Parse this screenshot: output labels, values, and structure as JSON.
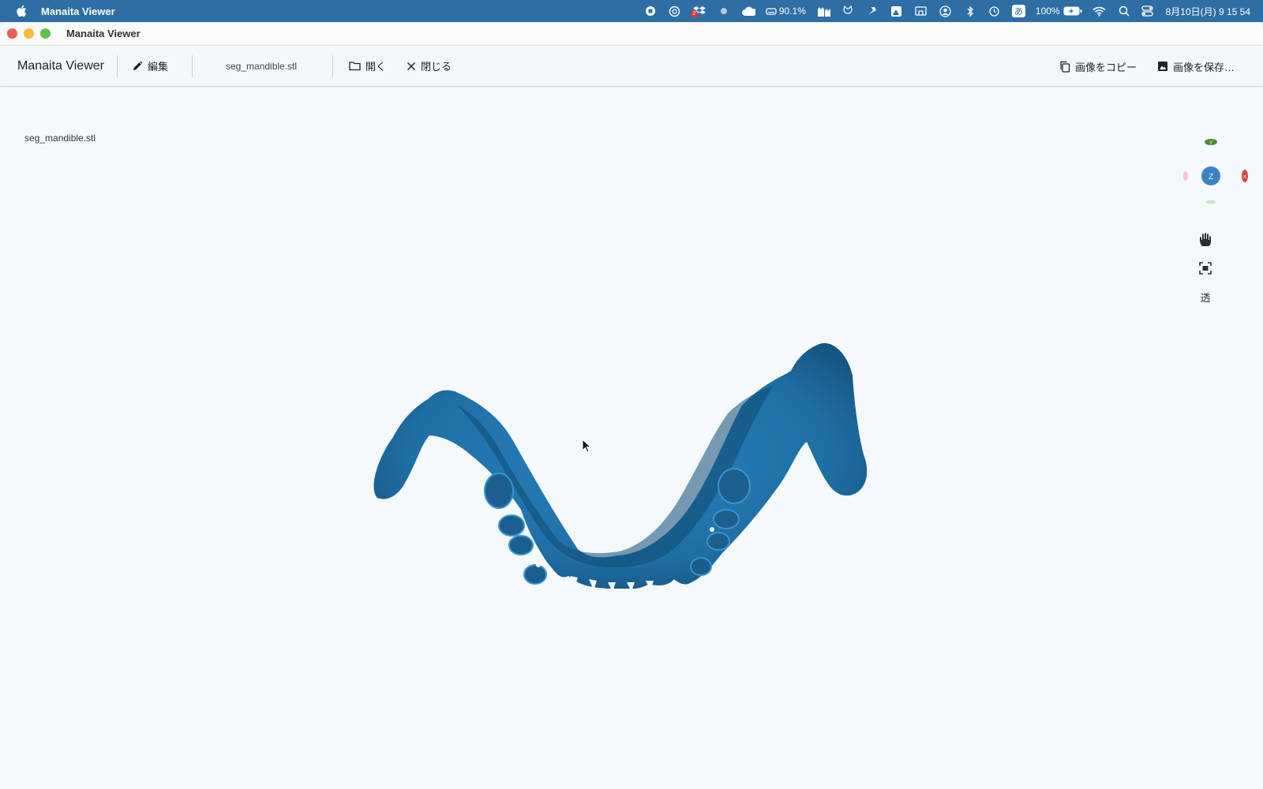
{
  "menubar": {
    "app_name": "Manaita Viewer",
    "disk_percent": "90.1%",
    "battery_percent": "100%",
    "ime": "あ",
    "clock": "8月10日(月)  9 15 54",
    "dropbox_badge": "2"
  },
  "window": {
    "title": "Manaita Viewer"
  },
  "toolbar": {
    "brand": "Manaita Viewer",
    "edit_label": "編集",
    "file_name": "seg_mandible.stl",
    "open_label": "開く",
    "close_label": "閉じる",
    "copy_image_label": "画像をコピー",
    "save_image_label": "画像を保存…"
  },
  "viewport": {
    "file_label": "seg_mandible.stl",
    "model_color": "#1f6fa6",
    "background": "#f4f9fc"
  },
  "gizmo": {
    "y_label": "Y",
    "z_label": "Z",
    "x_label": "X",
    "z_color": "#3b82c4",
    "x_color": "#d64545",
    "y_color": "#4f8a3b"
  },
  "side_tools": {
    "pan_icon": "hand-icon",
    "fit_icon": "fit-view-icon",
    "transparency_label": "透"
  }
}
